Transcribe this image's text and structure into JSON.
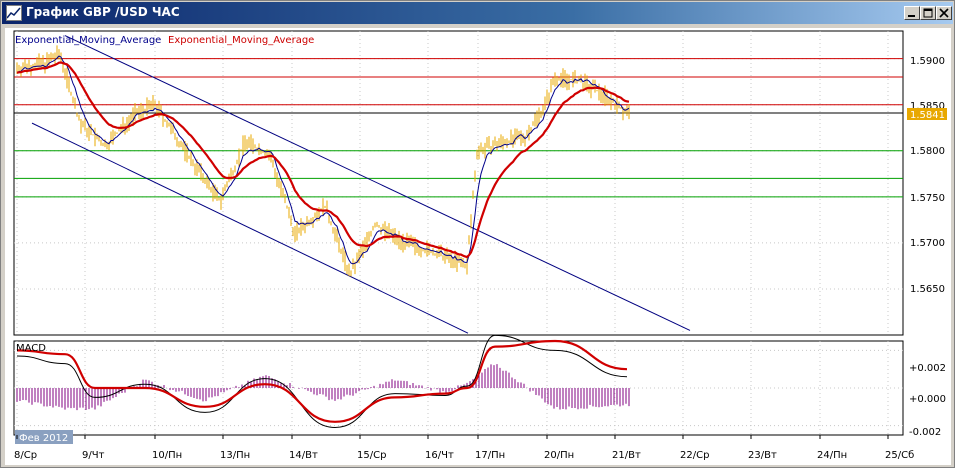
{
  "window": {
    "title": "График GBP /USD  ЧАС",
    "buttons": [
      "minimize",
      "maximize",
      "close"
    ]
  },
  "price_panel": {
    "legend": [
      {
        "text": "Exponential_Moving_Average",
        "color": "#0000a0"
      },
      {
        "text": "Exponential_Moving_Average",
        "color": "#cc0000"
      }
    ],
    "current_price": "1.5841",
    "price_axis_labels": [
      "1.5900",
      "1.5850",
      "1.5800",
      "1.5750",
      "1.5700",
      "1.5650"
    ]
  },
  "macd_panel": {
    "label": "MACD",
    "axis_labels": [
      "+0.002",
      "+0.000",
      "-0.002"
    ]
  },
  "time_axis": {
    "labels": [
      "8/Ср",
      "9/Чт",
      "10/Пн",
      "13/Пн",
      "14/Вт",
      "15/Ср",
      "16/Чт",
      "17/Пн",
      "20/Пн",
      "21/Вт",
      "22/Ср",
      "23/Вт",
      "24/Пн",
      "25/Сб"
    ],
    "period_badge": "Фев 2012"
  },
  "colors": {
    "candles": "#e8a800",
    "ema_fast": "#00008b",
    "ema_slow": "#d00000",
    "resistance": "#d00000",
    "support": "#00a000",
    "channel": "#000080",
    "current_line": "#000000",
    "price_tag_bg": "#e8a800",
    "macd_hist": "#800080"
  },
  "chart_data": {
    "type": "line",
    "x": [
      "8/Ср",
      "9/Чт",
      "10/Пн",
      "13/Пн",
      "14/Вт",
      "15/Ср",
      "16/Чт",
      "17/Пн",
      "20/Пн",
      "21/Вт"
    ],
    "series": [
      {
        "values": [
          1.5885,
          1.581,
          1.5855,
          1.5745,
          1.5795,
          1.5665,
          1.5695,
          1.568,
          1.5815,
          1.5873,
          1.584
        ]
      },
      {
        "values": [
          1.584,
          1.586,
          1.5845,
          1.5805,
          1.5795,
          1.5745,
          1.5718,
          1.5702,
          1.5762,
          1.5815,
          1.5825
        ]
      }
    ],
    "horizontal_levels": {
      "red": [
        1.59,
        1.588,
        1.585
      ],
      "green": [
        1.58,
        1.577,
        1.575
      ],
      "black": [
        1.5841
      ]
    },
    "ylim": [
      1.56,
      1.593
    ],
    "macd": {
      "ylim": [
        -0.0025,
        0.0025
      ],
      "line": [
        0.0017,
        0.0013,
        -0.0005,
        0.0002,
        -0.0013,
        0.0005,
        -0.0021,
        -0.0003,
        -0.0004,
        0.0001,
        0.0028,
        0.002,
        0.0006
      ],
      "signal": [
        0.002,
        0.0018,
        0.0,
        0.0,
        -0.001,
        0.0002,
        -0.0018,
        -0.0005,
        -0.0003,
        0.0,
        0.0022,
        0.0025,
        0.001
      ]
    }
  }
}
